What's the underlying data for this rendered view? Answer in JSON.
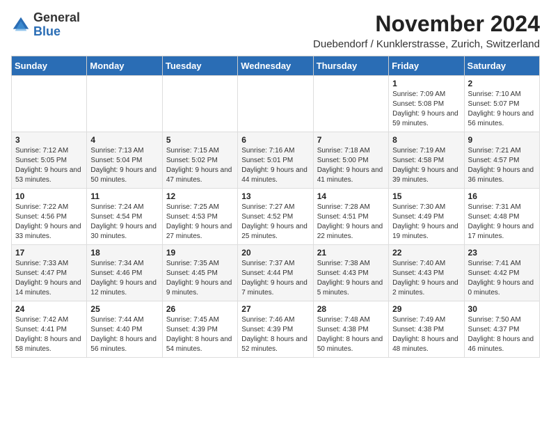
{
  "app": {
    "name": "GeneralBlue",
    "logo_text_1": "General",
    "logo_text_2": "Blue"
  },
  "calendar": {
    "month_title": "November 2024",
    "location": "Duebendorf / Kunklerstrasse, Zurich, Switzerland",
    "weekdays": [
      "Sunday",
      "Monday",
      "Tuesday",
      "Wednesday",
      "Thursday",
      "Friday",
      "Saturday"
    ],
    "weeks": [
      [
        {
          "day": "",
          "info": ""
        },
        {
          "day": "",
          "info": ""
        },
        {
          "day": "",
          "info": ""
        },
        {
          "day": "",
          "info": ""
        },
        {
          "day": "",
          "info": ""
        },
        {
          "day": "1",
          "info": "Sunrise: 7:09 AM\nSunset: 5:08 PM\nDaylight: 9 hours and 59 minutes."
        },
        {
          "day": "2",
          "info": "Sunrise: 7:10 AM\nSunset: 5:07 PM\nDaylight: 9 hours and 56 minutes."
        }
      ],
      [
        {
          "day": "3",
          "info": "Sunrise: 7:12 AM\nSunset: 5:05 PM\nDaylight: 9 hours and 53 minutes."
        },
        {
          "day": "4",
          "info": "Sunrise: 7:13 AM\nSunset: 5:04 PM\nDaylight: 9 hours and 50 minutes."
        },
        {
          "day": "5",
          "info": "Sunrise: 7:15 AM\nSunset: 5:02 PM\nDaylight: 9 hours and 47 minutes."
        },
        {
          "day": "6",
          "info": "Sunrise: 7:16 AM\nSunset: 5:01 PM\nDaylight: 9 hours and 44 minutes."
        },
        {
          "day": "7",
          "info": "Sunrise: 7:18 AM\nSunset: 5:00 PM\nDaylight: 9 hours and 41 minutes."
        },
        {
          "day": "8",
          "info": "Sunrise: 7:19 AM\nSunset: 4:58 PM\nDaylight: 9 hours and 39 minutes."
        },
        {
          "day": "9",
          "info": "Sunrise: 7:21 AM\nSunset: 4:57 PM\nDaylight: 9 hours and 36 minutes."
        }
      ],
      [
        {
          "day": "10",
          "info": "Sunrise: 7:22 AM\nSunset: 4:56 PM\nDaylight: 9 hours and 33 minutes."
        },
        {
          "day": "11",
          "info": "Sunrise: 7:24 AM\nSunset: 4:54 PM\nDaylight: 9 hours and 30 minutes."
        },
        {
          "day": "12",
          "info": "Sunrise: 7:25 AM\nSunset: 4:53 PM\nDaylight: 9 hours and 27 minutes."
        },
        {
          "day": "13",
          "info": "Sunrise: 7:27 AM\nSunset: 4:52 PM\nDaylight: 9 hours and 25 minutes."
        },
        {
          "day": "14",
          "info": "Sunrise: 7:28 AM\nSunset: 4:51 PM\nDaylight: 9 hours and 22 minutes."
        },
        {
          "day": "15",
          "info": "Sunrise: 7:30 AM\nSunset: 4:49 PM\nDaylight: 9 hours and 19 minutes."
        },
        {
          "day": "16",
          "info": "Sunrise: 7:31 AM\nSunset: 4:48 PM\nDaylight: 9 hours and 17 minutes."
        }
      ],
      [
        {
          "day": "17",
          "info": "Sunrise: 7:33 AM\nSunset: 4:47 PM\nDaylight: 9 hours and 14 minutes."
        },
        {
          "day": "18",
          "info": "Sunrise: 7:34 AM\nSunset: 4:46 PM\nDaylight: 9 hours and 12 minutes."
        },
        {
          "day": "19",
          "info": "Sunrise: 7:35 AM\nSunset: 4:45 PM\nDaylight: 9 hours and 9 minutes."
        },
        {
          "day": "20",
          "info": "Sunrise: 7:37 AM\nSunset: 4:44 PM\nDaylight: 9 hours and 7 minutes."
        },
        {
          "day": "21",
          "info": "Sunrise: 7:38 AM\nSunset: 4:43 PM\nDaylight: 9 hours and 5 minutes."
        },
        {
          "day": "22",
          "info": "Sunrise: 7:40 AM\nSunset: 4:43 PM\nDaylight: 9 hours and 2 minutes."
        },
        {
          "day": "23",
          "info": "Sunrise: 7:41 AM\nSunset: 4:42 PM\nDaylight: 9 hours and 0 minutes."
        }
      ],
      [
        {
          "day": "24",
          "info": "Sunrise: 7:42 AM\nSunset: 4:41 PM\nDaylight: 8 hours and 58 minutes."
        },
        {
          "day": "25",
          "info": "Sunrise: 7:44 AM\nSunset: 4:40 PM\nDaylight: 8 hours and 56 minutes."
        },
        {
          "day": "26",
          "info": "Sunrise: 7:45 AM\nSunset: 4:39 PM\nDaylight: 8 hours and 54 minutes."
        },
        {
          "day": "27",
          "info": "Sunrise: 7:46 AM\nSunset: 4:39 PM\nDaylight: 8 hours and 52 minutes."
        },
        {
          "day": "28",
          "info": "Sunrise: 7:48 AM\nSunset: 4:38 PM\nDaylight: 8 hours and 50 minutes."
        },
        {
          "day": "29",
          "info": "Sunrise: 7:49 AM\nSunset: 4:38 PM\nDaylight: 8 hours and 48 minutes."
        },
        {
          "day": "30",
          "info": "Sunrise: 7:50 AM\nSunset: 4:37 PM\nDaylight: 8 hours and 46 minutes."
        }
      ]
    ]
  }
}
